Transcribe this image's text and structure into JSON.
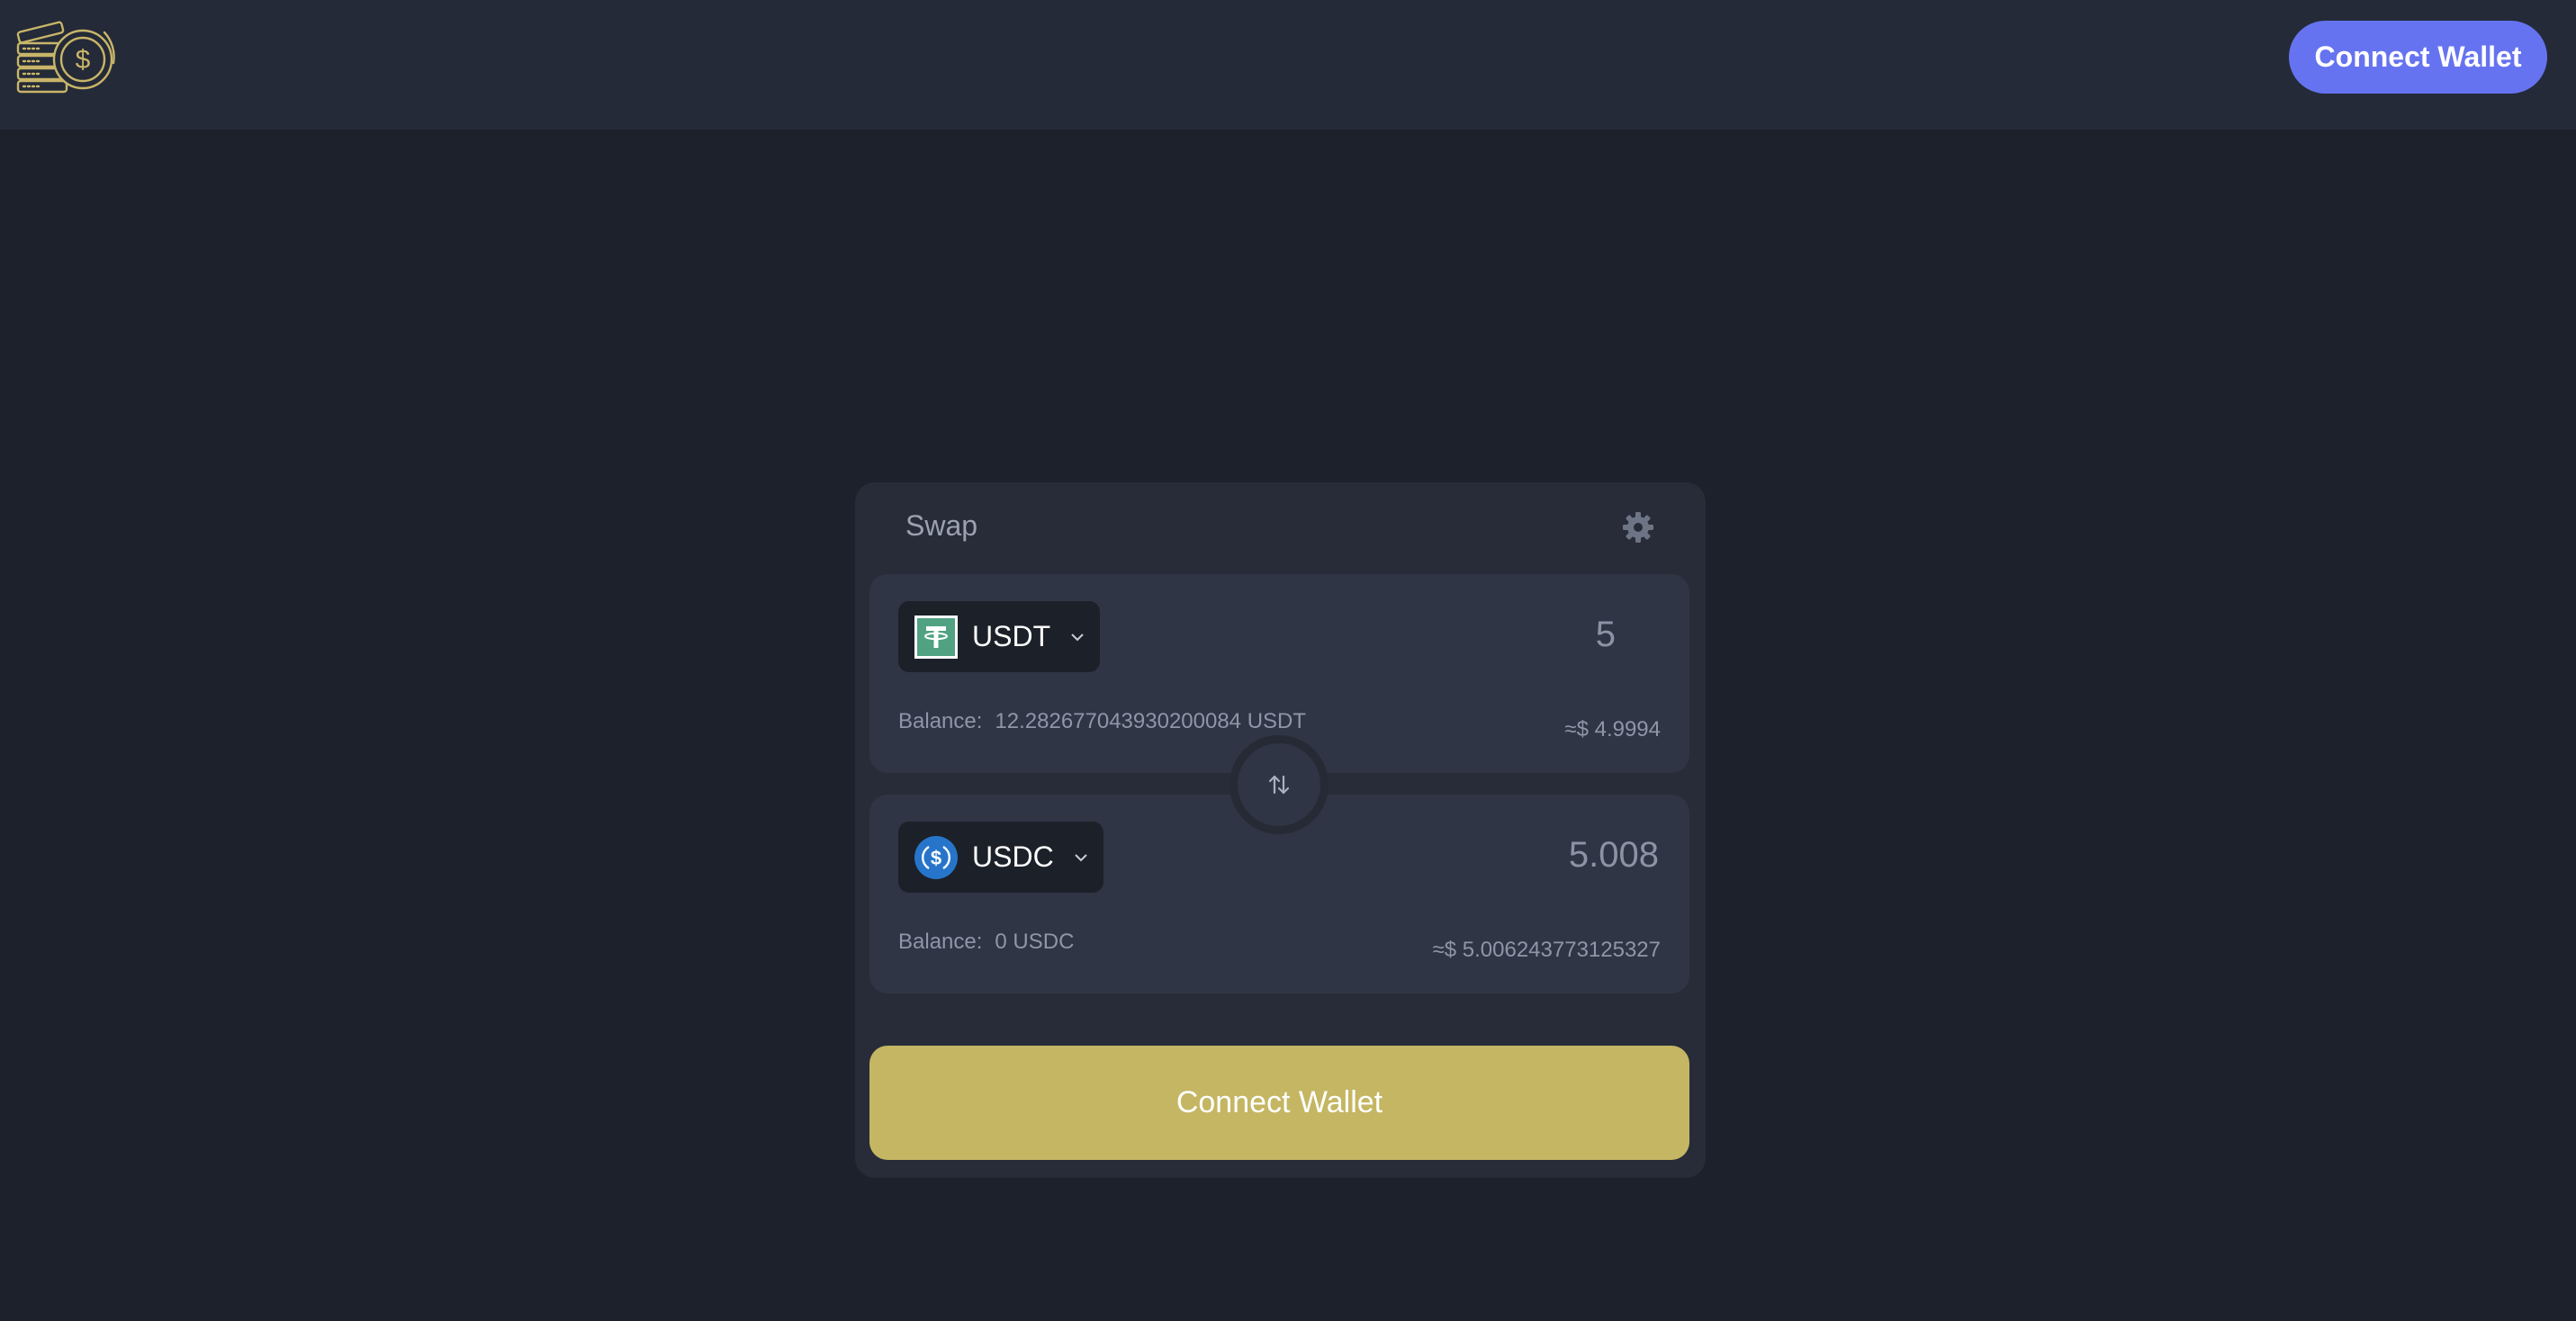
{
  "header": {
    "connect_label": "Connect Wallet",
    "logo_icon": "coins-dollar-icon"
  },
  "swap": {
    "title": "Swap",
    "settings_icon": "gear-icon",
    "switch_icon": "swap-arrows-icon",
    "from": {
      "token": "USDT",
      "token_icon": "tether-icon",
      "amount": "5",
      "balance_label": "Balance:",
      "balance_value": "12.282677043930200084 USDT",
      "usd_value": "≈$ 4.9994"
    },
    "to": {
      "token": "USDC",
      "token_icon": "usdc-icon",
      "amount": "5.008",
      "balance_label": "Balance:",
      "balance_value": "0 USDC",
      "usd_value": "≈$ 5.006243773125327"
    },
    "connect_label": "Connect Wallet"
  },
  "colors": {
    "background": "#1d212b",
    "header": "#242a37",
    "card": "#272c38",
    "panel": "#2f3544",
    "accent_button": "#6673f0",
    "primary_button": "#c4b663",
    "usdt": "#50a283",
    "usdc": "#2775ca"
  }
}
